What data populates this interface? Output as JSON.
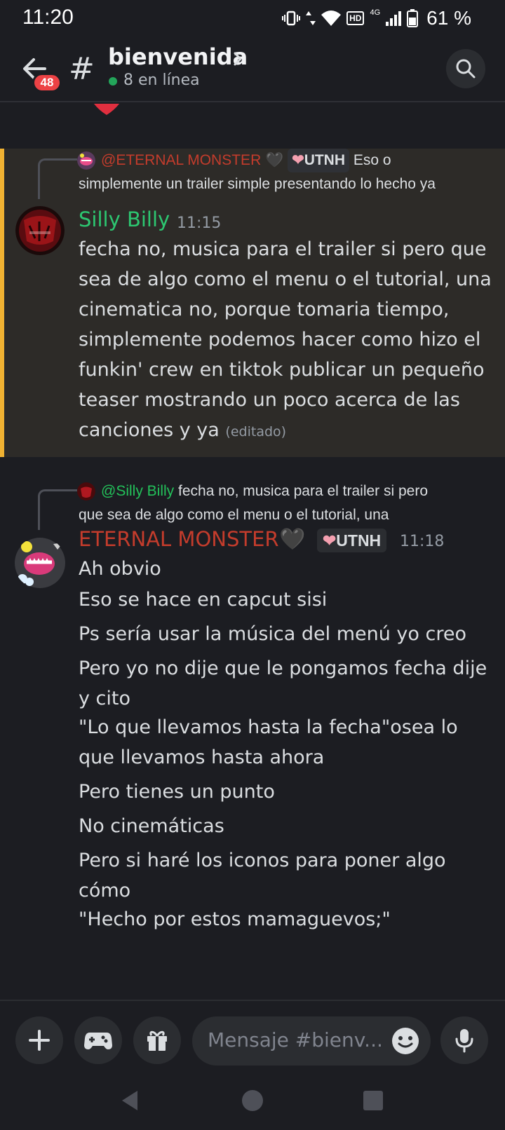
{
  "status_bar": {
    "time": "11:20",
    "battery": "61 %",
    "network": "4G",
    "hd": "HD"
  },
  "header": {
    "unread_badge": "48",
    "channel_name": "bienvenida",
    "online_count": "8 en línea"
  },
  "messages": [
    {
      "reply_to": {
        "author": "@ETERNAL MONSTER",
        "author_heart": "🖤",
        "role": "UTNH",
        "text_line1": "Eso o",
        "text_line2": "simplemente un trailer simple presentando lo hecho ya"
      },
      "author": "Silly Billy",
      "time": "11:15",
      "body": "fecha no, musica para el trailer si pero que sea de algo como el menu o el tutorial, una cinematica no, porque tomaria tiempo, simplemente podemos hacer como hizo el funkin' crew en tiktok publicar un pequeño teaser mostrando un poco acerca de las canciones y ya",
      "edited": "(editado)",
      "highlighted": true
    },
    {
      "reply_to": {
        "author": "@Silly Billy",
        "text_line1": "fecha no, musica para el trailer si pero",
        "text_line2": "que sea de algo como el menu o el tutorial, una"
      },
      "author": "ETERNAL MONSTER",
      "author_heart": "🖤",
      "role": "UTNH",
      "time": "11:18",
      "lines": [
        "Ah obvio",
        "Eso se hace en capcut sisi",
        "Ps sería usar la música del menú yo creo",
        "Pero yo no dije que le pongamos fecha dije y cito",
        "\"Lo que llevamos hasta la fecha\"osea lo que llevamos hasta ahora",
        "Pero tienes un punto",
        "No cinemáticas",
        "Pero si haré los iconos para poner algo cómo",
        "\"Hecho por estos mamaguevos;\""
      ]
    }
  ],
  "composer": {
    "placeholder": "Mensaje #bienv..."
  },
  "colors": {
    "background": "#1c1d22",
    "highlight": "#2d2b28",
    "highlight_bar": "#f0b232",
    "green_name": "#2dc771",
    "red_name": "#c43c2c",
    "badge": "#ed4245"
  },
  "icons": {
    "back": "arrow-left-icon",
    "channel": "hash-icon",
    "search": "search-icon",
    "add": "plus-icon",
    "games": "gamepad-icon",
    "gift": "gift-icon",
    "emoji": "emoji-icon",
    "mic": "microphone-icon"
  }
}
